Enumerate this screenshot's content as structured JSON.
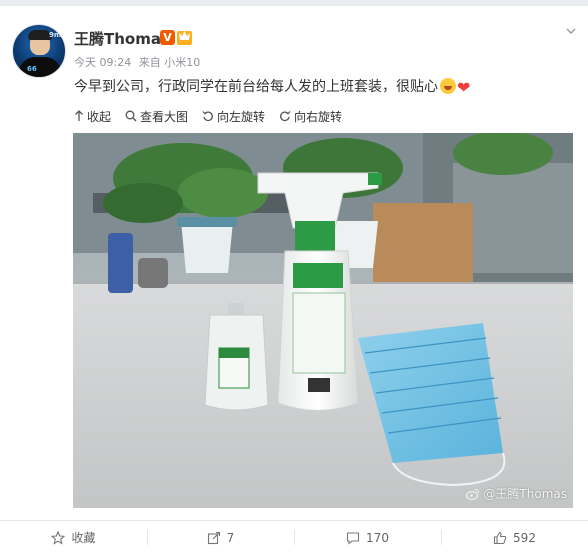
{
  "user": {
    "name": "王腾Thomas",
    "verified_badge": "V",
    "avatar_tag": "9ms",
    "avatar_screen_text": "66"
  },
  "meta": {
    "time": "今天 09:24",
    "source": "来自 小米10"
  },
  "post": {
    "text": "今早到公司，行政同学在前台给每人发的上班套装，很贴心",
    "emojis": [
      "laugh-emoji",
      "heart-emoji"
    ]
  },
  "media_toolbar": {
    "collapse": "收起",
    "view_large": "查看大图",
    "rotate_left": "向左旋转",
    "rotate_right": "向右旋转"
  },
  "photo": {
    "watermark": "@王腾Thomas"
  },
  "actions": {
    "favorite": "收藏",
    "repost_count": "7",
    "comment_count": "170",
    "like_count": "592"
  },
  "colors": {
    "accent": "#f25a00",
    "link": "#eb7350",
    "heart": "#f03c3c"
  }
}
